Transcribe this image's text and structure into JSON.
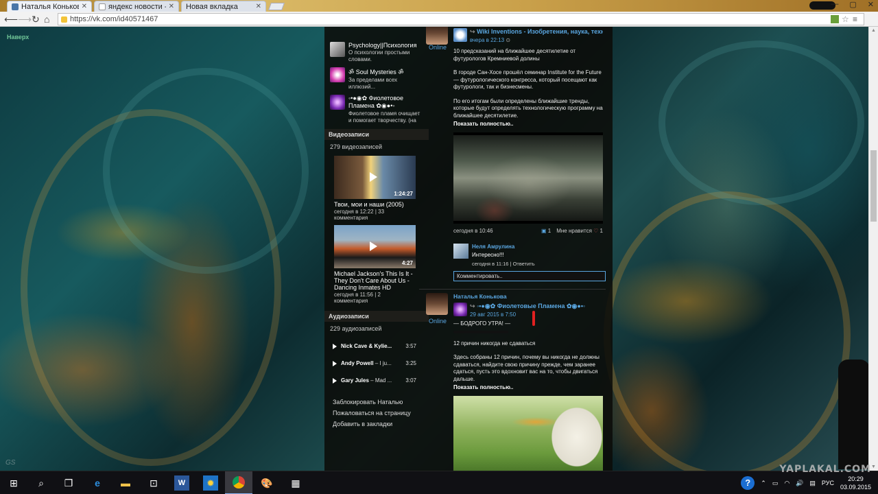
{
  "browser": {
    "tabs": [
      {
        "label": "Наталья Конькова",
        "active": true
      },
      {
        "label": "яндекс новости - По",
        "active": false
      },
      {
        "label": "Новая вкладка",
        "active": false
      }
    ],
    "url": "https://vk.com/id40571467"
  },
  "page": {
    "back_top": "Наверх",
    "watermark_left": "GS"
  },
  "groups": [
    {
      "name": "Psychology||Психология",
      "desc": "О психологии простыми словами."
    },
    {
      "name": "ॐ Soul Mysteries ॐ",
      "desc": "За пределами всех иллюзий..."
    },
    {
      "name": "◦•●◉✿ Фиолетовое Пламена ✿◉●•◦",
      "desc": "Фиолетовое пламя очищает и помогает творчеству. (на стене"
    }
  ],
  "videos_section": {
    "title": "Видеозаписи",
    "count": "279 видеозаписей",
    "items": [
      {
        "title": "Твои, мои и наши (2005)",
        "meta": "сегодня в 12:22 | 33 комментария",
        "duration": "1:24:27"
      },
      {
        "title": "Michael Jackson's This Is It - They Don't Care About Us - Dancing Inmates HD",
        "meta": "сегодня в 11:56 | 2 комментария",
        "duration": "4:27"
      }
    ]
  },
  "audio_section": {
    "title": "Аудиозаписи",
    "count": "229 аудиозаписей",
    "tracks": [
      {
        "artist": "Nick Cave & Kylie...",
        "title": "",
        "time": "3:57"
      },
      {
        "artist": "Andy Powell",
        "title": " – I ju...",
        "time": "3:25"
      },
      {
        "artist": "Gary Jules",
        "title": " – Mad ...",
        "time": "3:07"
      }
    ]
  },
  "profile_menu": [
    "Заблокировать Наталью",
    "Пожаловаться на страницу",
    "Добавить в закладки"
  ],
  "posts": [
    {
      "online": "Online",
      "source": "Wiki Inventions - Изобретения, наука, технол...",
      "date": "вчера в 22:13",
      "paragraphs": [
        "10 предсказаний на ближайшее десятилетие от футурологов Кремниевой долины",
        "В городе Сан-Хосе прошёл семинар Institute for the Future — футурологического конгресса, который посещают как футурологи, так и бизнесмены.",
        "По его итогам были определены ближайшие тренды, которые будут определять технологическую программу на ближайшее десятилетие."
      ],
      "more": "Показать полностью..",
      "footer_date": "сегодня в 10:46",
      "reposts": "1",
      "likes_label": "Мне нравится",
      "likes": "1",
      "comment": {
        "author": "Неля Амрулина",
        "text": "Интересно!!!",
        "meta": "сегодня в 11:16",
        "reply": "Ответить"
      },
      "comment_placeholder": "Комментировать.."
    },
    {
      "owner": "Наталья Конькова",
      "online": "Online",
      "source": "◦•●◉✿ Фиолетовые Пламена ✿◉●•◦",
      "date": "29 авг 2015 в 7:50",
      "paragraphs": [
        "— БОДРОГО УТРА! —",
        "12 причин никогда не сдаваться",
        "Здесь собраны 12 причин, почему вы никогда не должны сдаваться, найдите свою причину прежде, чем заранее сдаться, пусть это вдохновит вас на то, чтобы двигаться дальше."
      ],
      "more": "Показать полностью.."
    }
  ],
  "taskbar": {
    "lang": "РУС",
    "time": "20:29",
    "date": "03.09.2015",
    "watermark": "YAPLAKAL.COM"
  }
}
